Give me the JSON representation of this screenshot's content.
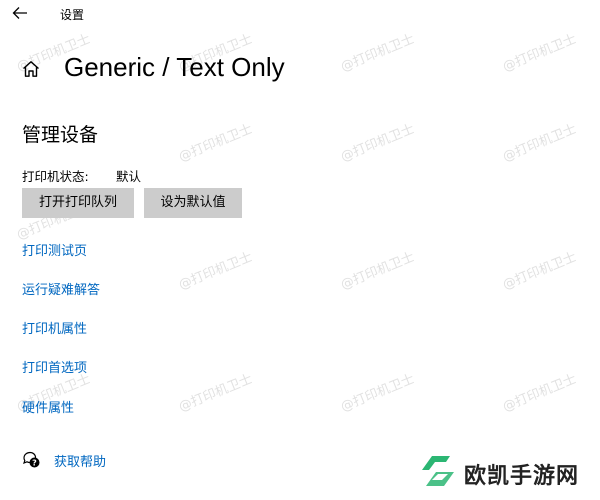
{
  "window": {
    "title": "设置"
  },
  "header": {
    "title": "Generic / Text Only"
  },
  "section": {
    "title": "管理设备"
  },
  "status": {
    "label": "打印机状态:",
    "value": "默认"
  },
  "buttons": {
    "open_queue": "打开打印队列",
    "set_default": "设为默认值"
  },
  "links": [
    "打印测试页",
    "运行疑难解答",
    "打印机属性",
    "打印首选项",
    "硬件属性"
  ],
  "help": {
    "label": "获取帮助"
  },
  "watermark": {
    "text": "@打印机卫士"
  },
  "brand": {
    "name": "欧凯手游网"
  },
  "colors": {
    "link": "#0067c0",
    "button_bg": "#cccccc",
    "brand_green": "#2bb673"
  },
  "icons": {
    "back": "back-arrow-icon",
    "home": "home-icon",
    "help": "help-chat-icon"
  }
}
